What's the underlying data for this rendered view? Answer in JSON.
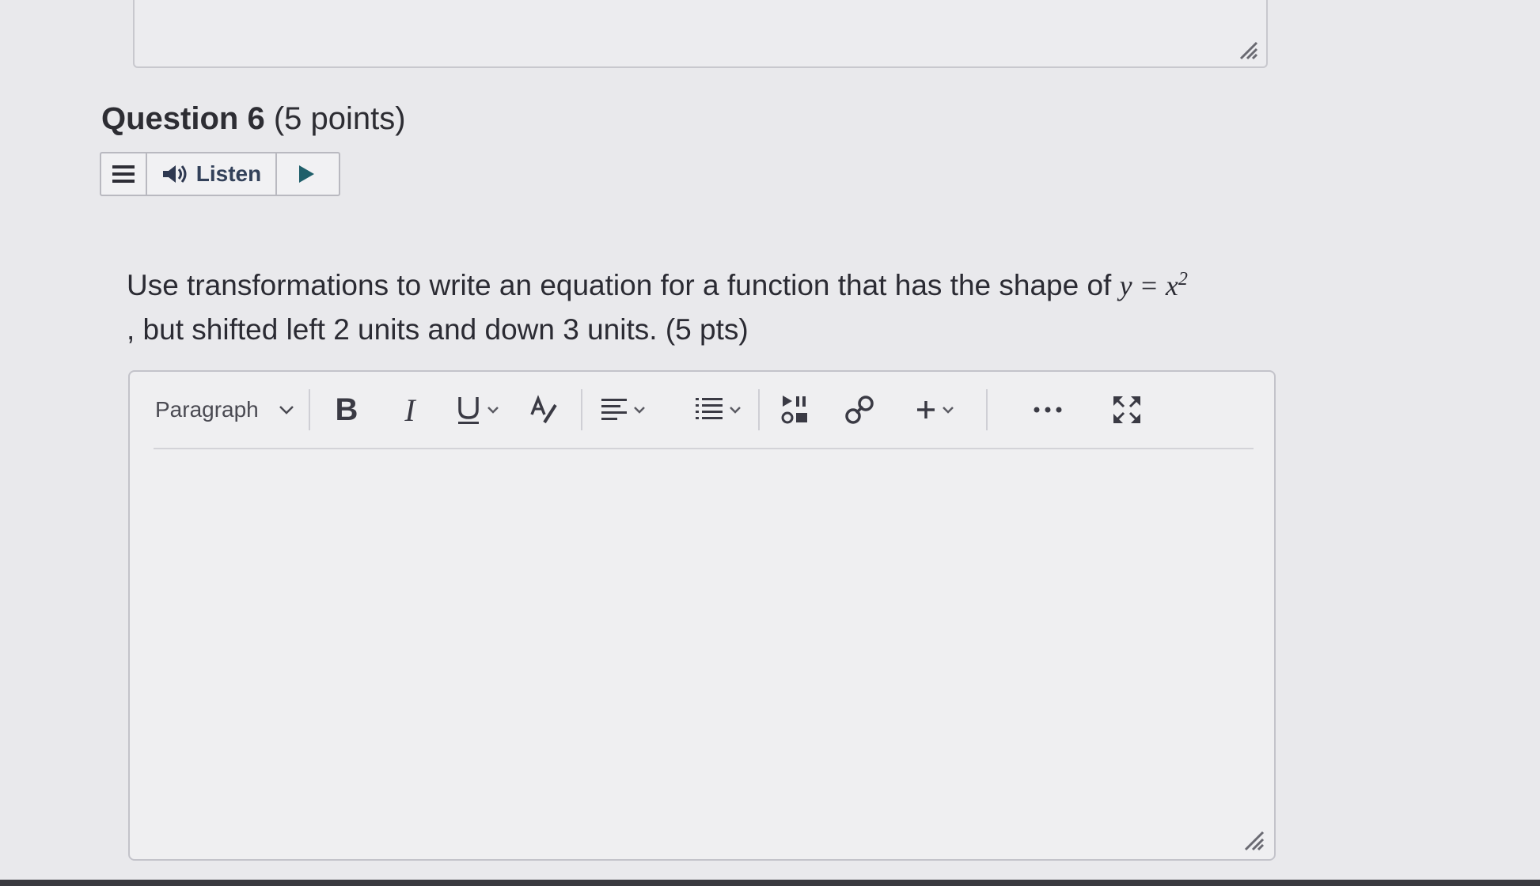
{
  "question": {
    "label": "Question 6",
    "points": "(5 points)",
    "text_part1": "Use transformations to write an equation for a function that has the shape of",
    "math_y": "y",
    "math_eq": "=",
    "math_x": "x",
    "math_exp": "2",
    "text_part2": ", but shifted left 2 units and down 3 units. (5 pts)"
  },
  "listen_bar": {
    "listen_label": "Listen",
    "icons": [
      "menu-icon",
      "speaker-icon",
      "play-icon"
    ]
  },
  "editor": {
    "format_select_value": "Paragraph",
    "bold_label": "B",
    "italic_label": "I",
    "icons": [
      "underline-icon",
      "text-color-icon",
      "align-icon",
      "list-icon",
      "media-icon",
      "link-icon",
      "plus-icon",
      "more-icon",
      "fullscreen-icon"
    ]
  }
}
